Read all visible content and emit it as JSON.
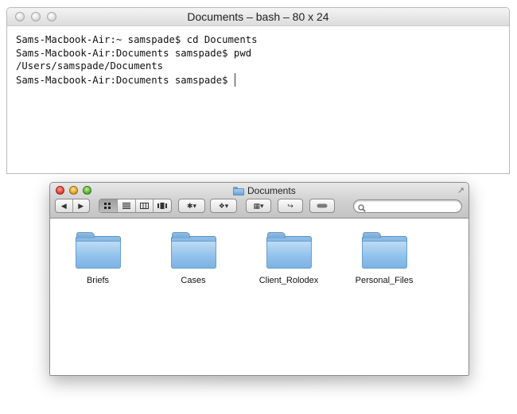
{
  "terminal": {
    "title": "Documents – bash – 80 x 24",
    "lines": [
      "Sams-Macbook-Air:~ samspade$ cd Documents",
      "Sams-Macbook-Air:Documents samspade$ pwd",
      "/Users/samspade/Documents",
      "Sams-Macbook-Air:Documents samspade$"
    ]
  },
  "finder": {
    "title": "Documents",
    "toolbar": {
      "back_glyph": "◀",
      "forward_glyph": "▶",
      "view_modes": [
        "icon-view",
        "list-view",
        "column-view",
        "coverflow-view"
      ],
      "active_view": "icon-view",
      "action_glyph": "✱▾",
      "dropbox_glyph": "❖▾",
      "arrange_glyph": "▦▾",
      "share_glyph": "↪",
      "tags_glyph": "▬"
    },
    "items": [
      {
        "name": "Briefs",
        "icon": "folder-icon"
      },
      {
        "name": "Cases",
        "icon": "folder-icon"
      },
      {
        "name": "Client_Rolodex",
        "icon": "folder-icon"
      },
      {
        "name": "Personal_Files",
        "icon": "folder-icon"
      }
    ]
  },
  "colors": {
    "folder_blue": "#8fc0ea",
    "close": "#e0443a",
    "minimize": "#e6a726",
    "zoom": "#5fb43a"
  }
}
